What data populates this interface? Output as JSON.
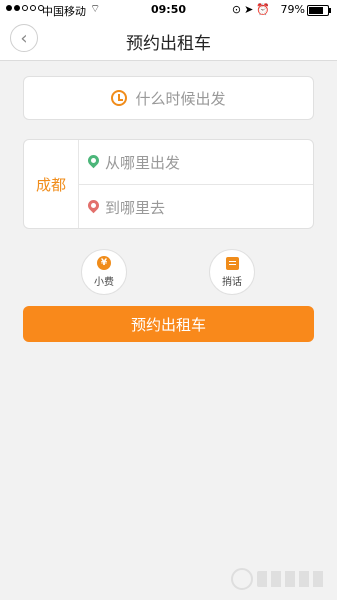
{
  "status_bar": {
    "carrier": "中国移动",
    "time": "09:50",
    "battery": "79%",
    "battery_level": 0.79
  },
  "nav": {
    "title": "预约出租车",
    "back_icon": "chevron-left-icon"
  },
  "time_picker": {
    "label": "什么时候出发",
    "icon": "clock-icon"
  },
  "route": {
    "city": "成都",
    "from_placeholder": "从哪里出发",
    "to_placeholder": "到哪里去"
  },
  "options": {
    "tip_label": "小费",
    "tip_symbol": "¥",
    "message_label": "捎话"
  },
  "submit_label": "预约出租车",
  "colors": {
    "accent": "#f9891b",
    "from_pin": "#4cb67a",
    "to_pin": "#e2706c"
  }
}
